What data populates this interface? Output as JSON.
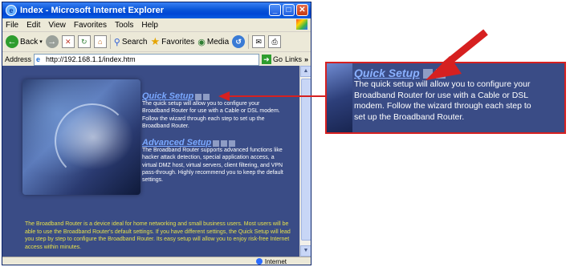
{
  "window": {
    "title": "Index - Microsoft Internet Explorer",
    "controls": {
      "minimize": "_",
      "maximize": "□",
      "close": "✕"
    }
  },
  "menubar": {
    "items": [
      "File",
      "Edit",
      "View",
      "Favorites",
      "Tools",
      "Help"
    ]
  },
  "toolbar": {
    "back_label": "Back",
    "search_label": "Search",
    "favorites_label": "Favorites",
    "media_label": "Media"
  },
  "addressbar": {
    "label": "Address",
    "url": "http://192.168.1.1/index.htm",
    "go_label": "Go",
    "links_label": "Links"
  },
  "statusbar": {
    "zone": "Internet"
  },
  "page": {
    "quick_setup": {
      "title": "Quick Setup",
      "description": "The quick setup will allow you to configure your Broadband Router for use with a Cable or DSL modem. Follow the wizard through each step to set up the Broadband Router."
    },
    "advanced_setup": {
      "title": "Advanced Setup",
      "description": "The Broadband Router supports advanced functions like hacker attack detection, special application access, a virtual DMZ host, virtual servers, client filtering, and VPN pass-through. Highly recommend you to keep the default settings."
    },
    "intro": "The Broadband Router is a device ideal for home networking and small business users. Most users will be able to use the Broadband Router's default settings. If you have different settings, the Quick Setup will lead you step by step to configure the Broadband Router. Its easy setup will allow you to enjoy risk-free Internet access within minutes."
  },
  "zoom": {
    "title": "Quick Setup",
    "lines": [
      "The quick setup will allow you to configure your",
      "Broadband Router for use with a Cable or DSL",
      "modem. Follow the wizard through each step to",
      "set up the Broadband Router."
    ]
  },
  "colors": {
    "page_bg": "#3a4c86",
    "link": "#7aa8ff",
    "intro_text": "#e6e04a",
    "callout": "#d62020"
  },
  "icons": [
    "ie-logo-icon",
    "back-arrow-icon",
    "forward-arrow-icon",
    "stop-icon",
    "refresh-icon",
    "home-icon",
    "search-icon",
    "favorites-star-icon",
    "media-icon",
    "history-icon",
    "mail-icon",
    "print-icon",
    "globe-icon"
  ]
}
